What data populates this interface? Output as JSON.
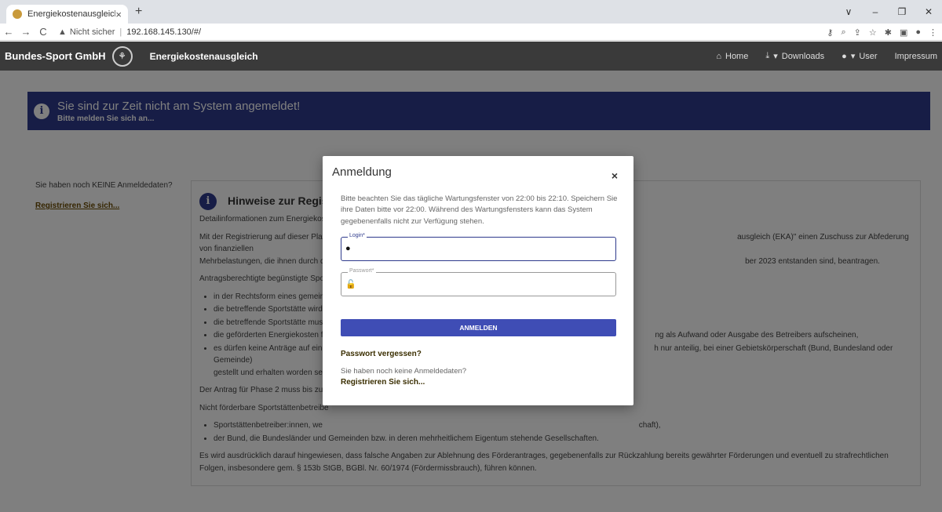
{
  "browser": {
    "tab_title": "Energiekostenausgleich",
    "tab_close": "×",
    "new_tab": "+",
    "security_label": "Nicht sicher",
    "url": "192.168.145.130/#/",
    "window_controls": [
      "∨",
      "–",
      "❐",
      "✕"
    ]
  },
  "header": {
    "brand": "Bundes-Sport GmbH",
    "app_title": "Energiekostenausgleich",
    "nav": {
      "home": "Home",
      "downloads": "Downloads",
      "user": "User",
      "impressum": "Impressum"
    }
  },
  "alert": {
    "title": "Sie sind zur Zeit nicht am System angemeldet!",
    "subtitle": "Bitte melden Sie sich an..."
  },
  "sidebar": {
    "no_credentials": "Sie haben noch KEINE Anmeldedaten?",
    "register_link": "Registrieren Sie sich..."
  },
  "panel": {
    "title": "Hinweise zur Registrier",
    "p1": "Detailinformationen zum Energiekost",
    "p2_left": "Mit der Registrierung auf dieser Platt",
    "p2_right": "ausgleich (EKA)\" einen Zuschuss zur Abfederung von finanziellen",
    "p2b_left": "Mehrbelastungen, die ihnen durch die",
    "p2b_right": "ber 2023 entstanden sind, beantragen.",
    "p3": "Antragsberechtigte begünstigte Spor",
    "bullets": [
      "in der Rechtsform eines gemeir",
      "die betreffende Sportstätte wird",
      "die betreffende Sportstätte mus",
      "die geförderten Energiekosten f",
      "es dürfen keine Anträge auf ein"
    ],
    "bullet4_right": "ng als Aufwand oder Ausgabe des Betreibers aufscheinen,",
    "bullet5_right": "h nur anteilig, bei einer Gebietskörperschaft (Bund, Bundesland oder Gemeinde)",
    "bullet5_cont": "gestellt und erhalten worden se",
    "p4": "Der Antrag für Phase 2 muss bis zum",
    "p5": "Nicht förderbare Sportstättenbetreibe",
    "nf_bullet1_left": "Sportstättenbetreiber:innen, we",
    "nf_bullet1_right": "chaft),",
    "nf_bullet2": "der Bund, die Bundesländer und Gemeinden bzw. in deren mehrheitlichem Eigentum stehende Gesellschaften.",
    "p6": "Es wird ausdrücklich darauf hingewiesen, dass falsche Angaben zur Ablehnung des Förderantrages, gegebenenfalls zur Rückzahlung bereits gewährter Förderungen und eventuell zu strafrechtlichen Folgen, insbesondere gem. § 153b StGB, BGBl. Nr. 60/1974 (Fördermissbrauch), führen können."
  },
  "modal": {
    "title": "Anmeldung",
    "close": "×",
    "info": "Bitte beachten Sie das tägliche Wartungsfenster von 22:00 bis 22:10. Speichern Sie ihre Daten bitte vor 22:00. Während des Wartungsfensters kann das System gegebenenfalls nicht zur Verfügung stehen.",
    "login_label": "Login*",
    "login_value": "",
    "password_label": "Passwort*",
    "password_value": "",
    "submit": "ANMELDEN",
    "forgot": "Passwort vergessen?",
    "no_credentials": "Sie haben noch keine Anmeldedaten?",
    "register": "Registrieren Sie sich..."
  },
  "colors": {
    "accent": "#2e3a8c",
    "button": "#3f4db5",
    "header": "#3a3a3a"
  }
}
